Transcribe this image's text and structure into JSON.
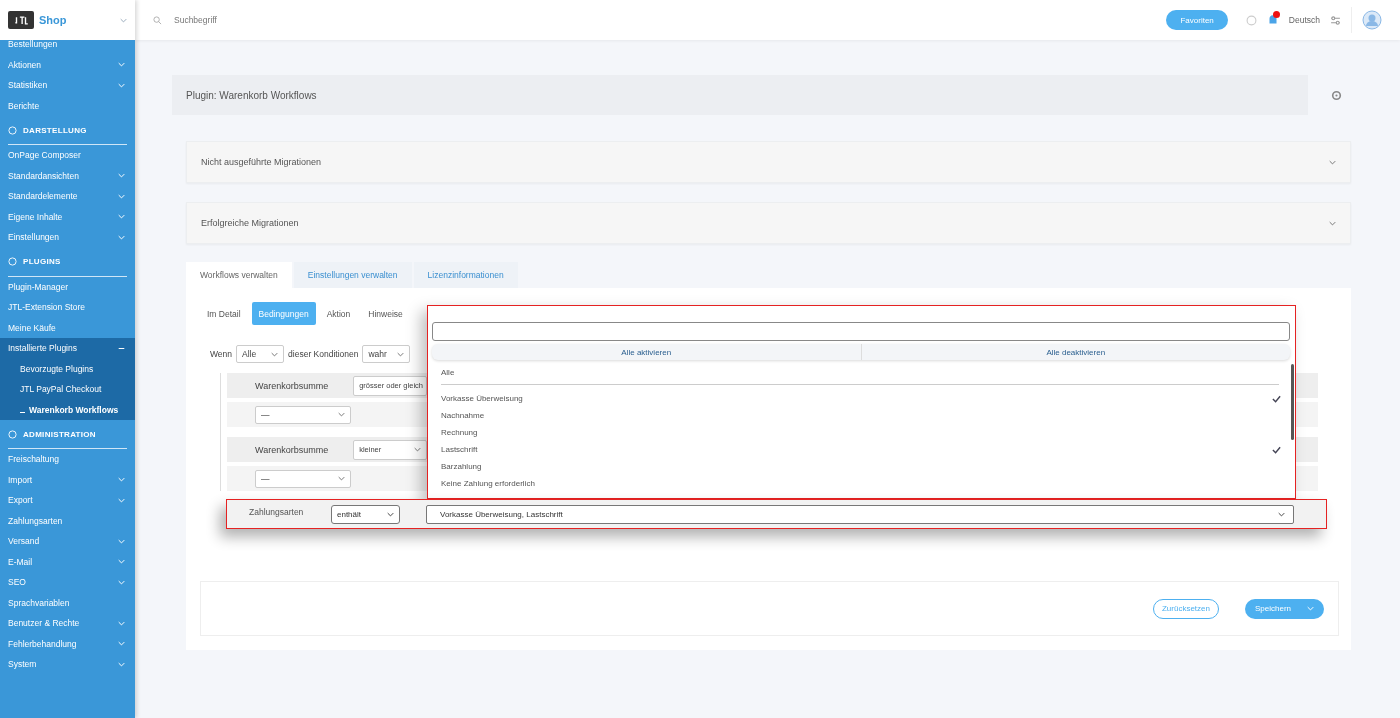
{
  "topbar": {
    "logo": "Shop",
    "search_placeholder": "Suchbegriff",
    "favorites_button": "Favoriten",
    "language": "Deutsch"
  },
  "sidebar": {
    "items": [
      {
        "kind": "item",
        "label": "Bestellungen",
        "expandable": false,
        "selected": false
      },
      {
        "kind": "item",
        "label": "Aktionen",
        "expandable": true,
        "selected": false
      },
      {
        "kind": "item",
        "label": "Statistiken",
        "expandable": true,
        "selected": false
      },
      {
        "kind": "item",
        "label": "Berichte",
        "expandable": false,
        "selected": false
      },
      {
        "kind": "section",
        "label": "DARSTELLUNG"
      },
      {
        "kind": "item",
        "label": "OnPage Composer",
        "expandable": false,
        "selected": false
      },
      {
        "kind": "item",
        "label": "Standardansichten",
        "expandable": true,
        "selected": false
      },
      {
        "kind": "item",
        "label": "Standardelemente",
        "expandable": true,
        "selected": false
      },
      {
        "kind": "item",
        "label": "Eigene Inhalte",
        "expandable": true,
        "selected": false
      },
      {
        "kind": "item",
        "label": "Einstellungen",
        "expandable": true,
        "selected": false
      },
      {
        "kind": "section",
        "label": "PLUGINS"
      },
      {
        "kind": "item",
        "label": "Plugin-Manager",
        "expandable": false,
        "selected": false
      },
      {
        "kind": "item",
        "label": "JTL-Extension Store",
        "expandable": false,
        "selected": false
      },
      {
        "kind": "item",
        "label": "Meine Käufe",
        "expandable": false,
        "selected": false
      },
      {
        "kind": "item",
        "label": "Installierte Plugins",
        "expandable": true,
        "expanded": true,
        "selected": false,
        "children": [
          {
            "label": "Bevorzugte Plugins",
            "selected": false
          },
          {
            "label": "JTL PayPal Checkout",
            "selected": false
          },
          {
            "label": "Warenkorb Workflows",
            "selected": true
          }
        ]
      },
      {
        "kind": "section",
        "label": "ADMINISTRATION"
      },
      {
        "kind": "item",
        "label": "Freischaltung",
        "expandable": false,
        "selected": false
      },
      {
        "kind": "item",
        "label": "Import",
        "expandable": true,
        "selected": false
      },
      {
        "kind": "item",
        "label": "Export",
        "expandable": true,
        "selected": false
      },
      {
        "kind": "item",
        "label": "Zahlungsarten",
        "expandable": false,
        "selected": false
      },
      {
        "kind": "item",
        "label": "Versand",
        "expandable": true,
        "selected": false
      },
      {
        "kind": "item",
        "label": "E-Mail",
        "expandable": true,
        "selected": false
      },
      {
        "kind": "item",
        "label": "SEO",
        "expandable": true,
        "selected": false
      },
      {
        "kind": "item",
        "label": "Sprachvariablen",
        "expandable": false,
        "selected": false
      },
      {
        "kind": "item",
        "label": "Benutzer & Rechte",
        "expandable": true,
        "selected": false
      },
      {
        "kind": "item",
        "label": "Fehlerbehandlung",
        "expandable": true,
        "selected": false
      },
      {
        "kind": "item",
        "label": "System",
        "expandable": true,
        "selected": false
      }
    ]
  },
  "main": {
    "title": "Plugin: Warenkorb Workflows",
    "panels": [
      "Nicht ausgeführte Migrationen",
      "Erfolgreiche Migrationen"
    ],
    "tabs": [
      {
        "label": "Workflows verwalten",
        "selected": true
      },
      {
        "label": "Einstellungen verwalten",
        "selected": false
      },
      {
        "label": "Lizenzinformationen",
        "selected": false
      }
    ],
    "subtabs": [
      {
        "label": "Im Detail",
        "selected": false
      },
      {
        "label": "Bedingungen",
        "selected": true
      },
      {
        "label": "Aktion",
        "selected": false
      },
      {
        "label": "Hinweise",
        "selected": false
      }
    ],
    "rule_line": {
      "prefix": "Wenn",
      "quantifier": "Alle",
      "middle": "dieser Konditionen",
      "truth": "wahr"
    },
    "conditions": [
      {
        "field": "Warenkorbsumme",
        "operator": "grösser oder gleich",
        "sub_select": "—"
      },
      {
        "field": "Warenkorbsumme",
        "operator": "kleiner",
        "sub_select": "—"
      }
    ],
    "footer_buttons": [
      "Zurücksetzen",
      "Speichern"
    ]
  },
  "highlighted_condition": {
    "field": "Zahlungsarten",
    "operator": "enthält",
    "value": "Vorkasse Überweisung, Lastschrift"
  },
  "dropdown": {
    "buttons": [
      "Alle aktivieren",
      "Alle deaktivieren"
    ],
    "all_option": "Alle",
    "options": [
      {
        "label": "Vorkasse Überweisung",
        "checked": true
      },
      {
        "label": "Nachnahme",
        "checked": false
      },
      {
        "label": "Rechnung",
        "checked": false
      },
      {
        "label": "Lastschrift",
        "checked": true
      },
      {
        "label": "Barzahlung",
        "checked": false
      },
      {
        "label": "Keine Zahlung erforderlich",
        "checked": false
      }
    ]
  }
}
